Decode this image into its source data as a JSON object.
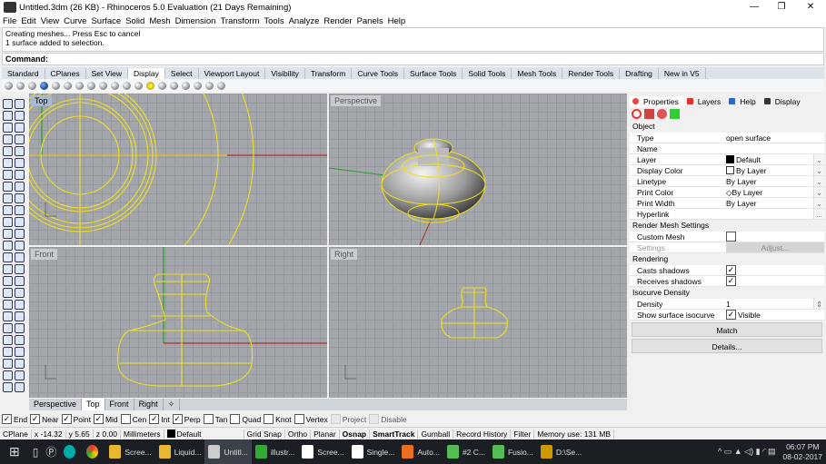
{
  "window": {
    "title": "Untitled.3dm (26 KB) - Rhinoceros 5.0 Evaluation (21 Days Remaining)",
    "controls": [
      "—",
      "❐",
      "✕"
    ]
  },
  "menu": [
    "File",
    "Edit",
    "View",
    "Curve",
    "Surface",
    "Solid",
    "Mesh",
    "Dimension",
    "Transform",
    "Tools",
    "Analyze",
    "Render",
    "Panels",
    "Help"
  ],
  "command": {
    "history": [
      "Creating meshes... Press Esc to cancel",
      "1 surface added to selection."
    ],
    "prompt": "Command:"
  },
  "toolbar_tabs": {
    "items": [
      "Standard",
      "CPlanes",
      "Set View",
      "Display",
      "Select",
      "Viewport Layout",
      "Visibility",
      "Transform",
      "Curve Tools",
      "Surface Tools",
      "Solid Tools",
      "Mesh Tools",
      "Render Tools",
      "Drafting",
      "New in V5"
    ],
    "active": "Display"
  },
  "viewports": {
    "top": "Top",
    "perspective": "Perspective",
    "front": "Front",
    "right": "Right"
  },
  "viewport_tabs": {
    "items": [
      "Perspective",
      "Top",
      "Front",
      "Right",
      "✧"
    ],
    "active": "Top"
  },
  "osnap": [
    {
      "label": "End",
      "checked": true
    },
    {
      "label": "Near",
      "checked": true
    },
    {
      "label": "Point",
      "checked": true
    },
    {
      "label": "Mid",
      "checked": true
    },
    {
      "label": "Cen",
      "checked": false
    },
    {
      "label": "Int",
      "checked": true
    },
    {
      "label": "Perp",
      "checked": true
    },
    {
      "label": "Tan",
      "checked": false
    },
    {
      "label": "Quad",
      "checked": false
    },
    {
      "label": "Knot",
      "checked": false
    },
    {
      "label": "Vertex",
      "checked": false
    },
    {
      "label": "Project",
      "checked": false,
      "disabled": true
    },
    {
      "label": "Disable",
      "checked": false,
      "disabled": true
    }
  ],
  "status": {
    "cplane": "CPlane",
    "x": "x -14.32",
    "y": "y 5.65",
    "z": "z 0.00",
    "units": "Millimeters",
    "layer": "Default",
    "toggles": [
      "Grid Snap",
      "Ortho",
      "Planar",
      "Osnap",
      "SmartTrack",
      "Gumball",
      "Record History",
      "Filter"
    ],
    "memory": "Memory use: 131 MB"
  },
  "panel": {
    "tabs": [
      "Properties",
      "Layers",
      "Help",
      "Display"
    ],
    "active_tab": "Properties",
    "sections": {
      "object": "Object",
      "render_mesh": "Render Mesh Settings",
      "rendering": "Rendering",
      "isocurve": "Isocurve Density"
    },
    "type": {
      "label": "Type",
      "value": "open surface"
    },
    "name": {
      "label": "Name",
      "value": ""
    },
    "layer": {
      "label": "Layer",
      "value": "Default"
    },
    "display_color": {
      "label": "Display Color",
      "value": "By Layer"
    },
    "linetype": {
      "label": "Linetype",
      "value": "By Layer"
    },
    "print_color": {
      "label": "Print Color",
      "value": "By Layer"
    },
    "print_width": {
      "label": "Print Width",
      "value": "By Layer"
    },
    "hyperlink": {
      "label": "Hyperlink",
      "value": "",
      "button": "..."
    },
    "custom_mesh": {
      "label": "Custom Mesh",
      "checked": false
    },
    "settings": {
      "label": "Settings",
      "button": "Adjust..."
    },
    "casts_shadows": {
      "label": "Casts shadows",
      "checked": true
    },
    "receives_shadows": {
      "label": "Receives shadows",
      "checked": true
    },
    "density": {
      "label": "Density",
      "value": "1"
    },
    "show_isocurve": {
      "label": "Show surface isocurve",
      "value": "Visible",
      "checked": true
    },
    "match": "Match",
    "details": "Details..."
  },
  "taskbar": {
    "items": [
      "Scree...",
      "Liquid...",
      "Untitl...",
      "illustr...",
      "Scree...",
      "Single...",
      "Auto...",
      "#2 C...",
      "Fusio...",
      "D:\\Se..."
    ],
    "active": "Untitl...",
    "time": "06:07 PM",
    "date": "08-02-2017"
  },
  "colors": {
    "curve": "#f0e020",
    "x_axis": "#b03030",
    "y_axis": "#2a9a2a",
    "viewport_bg": "#a3a6aa"
  }
}
